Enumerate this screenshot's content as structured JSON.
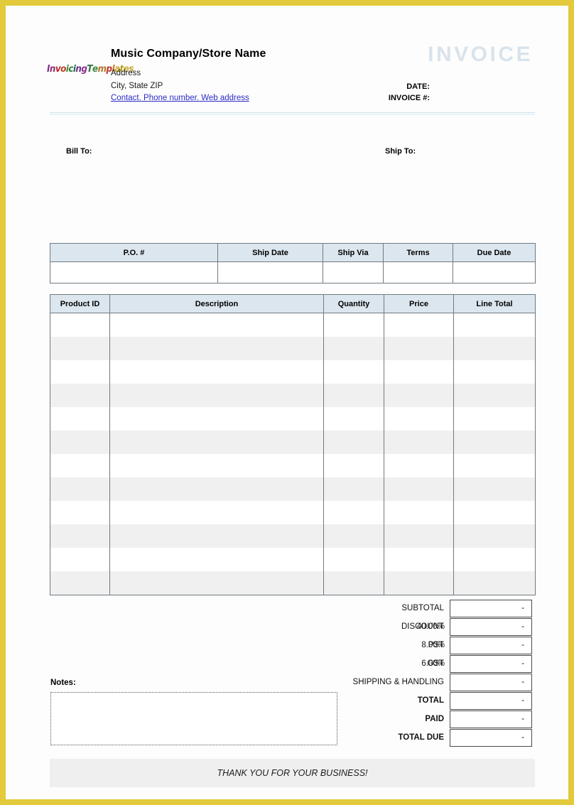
{
  "document": {
    "type": "invoice-template",
    "title_watermark": "INVOICE"
  },
  "colors": {
    "page_border": "#e3c93c",
    "table_header_fill": "#dce6ee",
    "table_border": "#6f7a82",
    "row_stripe": "#f0f0f0",
    "watermark": "#d9e3ec",
    "link": "#2b2bc8",
    "footer_fill": "#efefef"
  },
  "header": {
    "logo": {
      "name": "InvoicingTemplates",
      "letters": [
        {
          "ch": "I",
          "color": "#7b2d8e"
        },
        {
          "ch": "n",
          "color": "#8e2d6e"
        },
        {
          "ch": "v",
          "color": "#b02a2a"
        },
        {
          "ch": "o",
          "color": "#c23b1f"
        },
        {
          "ch": "i",
          "color": "#3f8f3f"
        },
        {
          "ch": "c",
          "color": "#2f7a3a"
        },
        {
          "ch": "i",
          "color": "#1f6e4a"
        },
        {
          "ch": "n",
          "color": "#6a2d8e"
        },
        {
          "ch": "g",
          "color": "#8e2d8e"
        },
        {
          "ch": "T",
          "color": "#2f6f3a"
        },
        {
          "ch": "e",
          "color": "#3d8a3d"
        },
        {
          "ch": "m",
          "color": "#b0762a"
        },
        {
          "ch": "p",
          "color": "#c0392b"
        },
        {
          "ch": "l",
          "color": "#c87a2a"
        },
        {
          "ch": "a",
          "color": "#c9a227"
        },
        {
          "ch": "t",
          "color": "#b5a22b"
        },
        {
          "ch": "e",
          "color": "#c9b037"
        },
        {
          "ch": "s",
          "color": "#caa53a"
        }
      ]
    },
    "company_name": "Music Company/Store Name",
    "address_line1": "Address",
    "address_line2": "City, State ZIP",
    "contact_link": "Contact. Phone number. Web address",
    "date_label": "DATE:",
    "invoice_number_label": "INVOICE #:"
  },
  "parties": {
    "bill_to_label": "Bill To:",
    "ship_to_label": "Ship To:"
  },
  "order_table": {
    "columns": [
      "P.O. #",
      "Ship Date",
      "Ship Via",
      "Terms",
      "Due Date"
    ],
    "rows": [
      [
        "",
        "",
        "",
        "",
        ""
      ]
    ]
  },
  "items_table": {
    "columns": [
      "Product ID",
      "Description",
      "Quantity",
      "Price",
      "Line Total"
    ],
    "row_count": 12,
    "rows": [
      [
        "",
        "",
        "",
        "",
        ""
      ],
      [
        "",
        "",
        "",
        "",
        ""
      ],
      [
        "",
        "",
        "",
        "",
        ""
      ],
      [
        "",
        "",
        "",
        "",
        ""
      ],
      [
        "",
        "",
        "",
        "",
        ""
      ],
      [
        "",
        "",
        "",
        "",
        ""
      ],
      [
        "",
        "",
        "",
        "",
        ""
      ],
      [
        "",
        "",
        "",
        "",
        ""
      ],
      [
        "",
        "",
        "",
        "",
        ""
      ],
      [
        "",
        "",
        "",
        "",
        ""
      ],
      [
        "",
        "",
        "",
        "",
        ""
      ],
      [
        "",
        "",
        "",
        "",
        ""
      ]
    ]
  },
  "totals": [
    {
      "label": "SUBTOTAL",
      "percent": "",
      "value": "-",
      "bold": false
    },
    {
      "label": "DISCOUNT",
      "percent": "40.00%",
      "value": "-",
      "bold": false
    },
    {
      "label": "PST",
      "percent": "8.00%",
      "value": "-",
      "bold": false
    },
    {
      "label": "GST",
      "percent": "6.00%",
      "value": "-",
      "bold": false
    },
    {
      "label": "SHIPPING & HANDLING",
      "percent": "",
      "value": "-",
      "bold": false
    },
    {
      "label": "TOTAL",
      "percent": "",
      "value": "-",
      "bold": true
    },
    {
      "label": "PAID",
      "percent": "",
      "value": "-",
      "bold": true
    },
    {
      "label": "TOTAL DUE",
      "percent": "",
      "value": "-",
      "bold": true
    }
  ],
  "notes": {
    "label": "Notes:",
    "value": ""
  },
  "footer": {
    "message": "THANK YOU FOR YOUR BUSINESS!"
  }
}
